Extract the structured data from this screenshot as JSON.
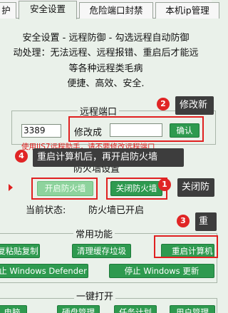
{
  "tabs": [
    "护",
    "安全设置",
    "危险端口封禁",
    "本机ip管理"
  ],
  "intro": {
    "line1": "安全设置 - 远程防御 - 勾选远程自动防御",
    "line2": "动处理：无法远程、远程报错、重启后才能远",
    "line3": "等各种远程类毛病",
    "line4": "便捷、高效、安全."
  },
  "remote_port": {
    "legend": "远程端口",
    "port_value": "3389",
    "modify_label": "修改成",
    "new_port_value": "",
    "confirm_label": "确认",
    "hint": "使用IIS7远程助手，请不要修改远程端口"
  },
  "firewall": {
    "legend": "防火墙设置",
    "open_label": "开启防火墙",
    "close_label": "关闭防火墙",
    "status_label": "当前状态:",
    "status_value": "防火墙已开启"
  },
  "common": {
    "legend": "常用功能",
    "btn_paste": "复粘贴复制",
    "btn_clear": "清理缓存垃圾",
    "btn_restart": "重启计算机",
    "btn_defender": "止 Windows Defender",
    "btn_update": "停止 Windows 更新"
  },
  "oneclick": {
    "legend": "一键打开",
    "btn1": "电脑",
    "btn2": "硬盘管理",
    "btn3": "任务计划",
    "btn4": "用户管理"
  },
  "annotations": {
    "tip1": "关闭防",
    "tip2": "修改新",
    "tip3": "重",
    "tip4": "重启计算机后，再开启防火墙",
    "badge1": "1",
    "badge2": "2",
    "badge3": "3",
    "badge4": "4"
  },
  "colors": {
    "button_green": "#2e9a4f",
    "annotation_red": "#e02020",
    "background": "#eaf1ea"
  }
}
